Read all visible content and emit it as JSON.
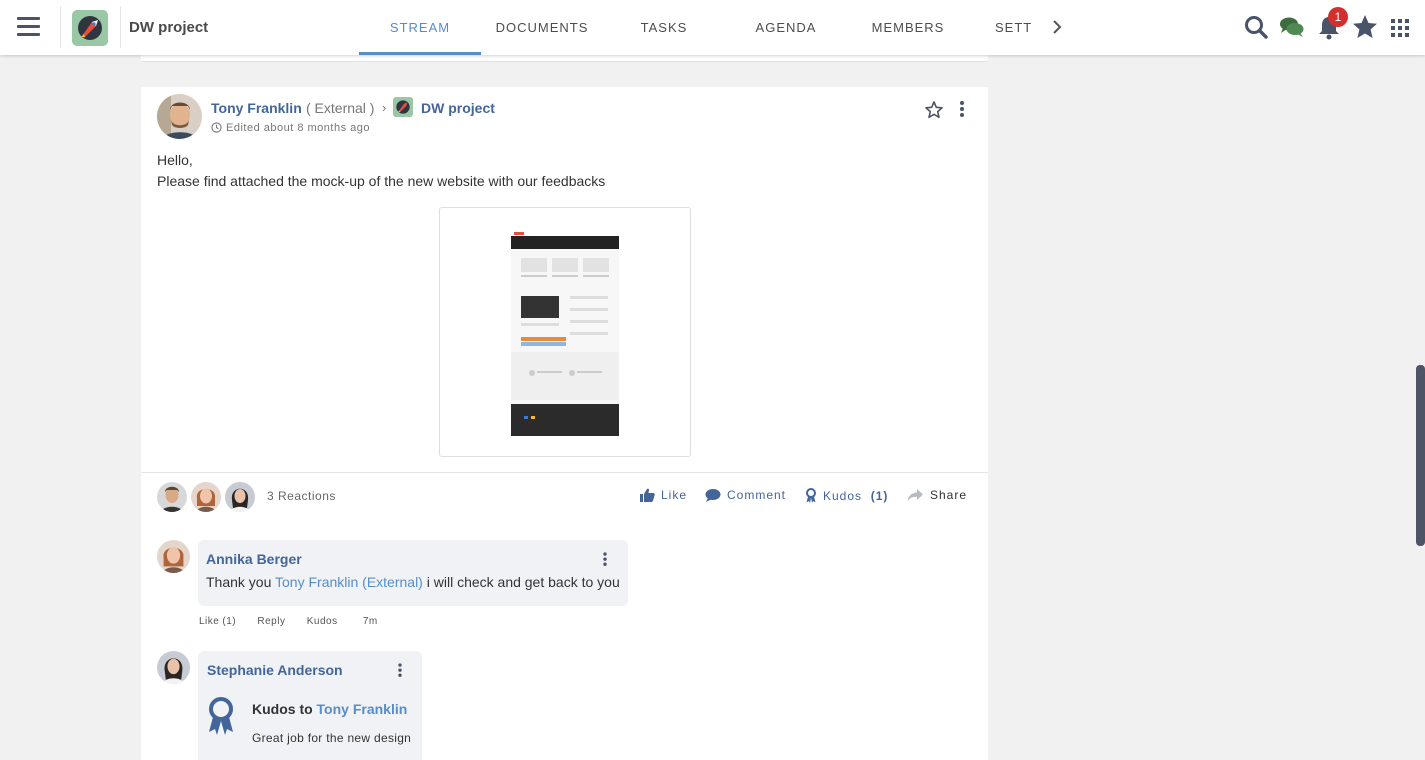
{
  "app": {
    "space_name": "DW project"
  },
  "tabs": [
    "STREAM",
    "DOCUMENTS",
    "TASKS",
    "AGENDA",
    "MEMBERS",
    "SETT"
  ],
  "active_tab": "STREAM",
  "notifications": {
    "count": "1"
  },
  "colors": {
    "accent": "#578dc9",
    "link": "#43659a",
    "badge": "#d32f2f",
    "chat": "#3d6d3f",
    "icon": "#4a5468"
  },
  "icons": [
    "hamburger-icon",
    "search-icon",
    "chat-icon",
    "bell-icon",
    "star-icon",
    "apps-grid-icon"
  ],
  "post": {
    "author": "Tony Franklin",
    "author_tag": "( External )",
    "space": "DW project",
    "edited": "Edited about 8 months ago",
    "body_line1": "Hello,",
    "body_line2": "Please find attached the mock-up of the new website with our feedbacks",
    "reactions": "3 Reactions",
    "actions": {
      "like": "Like",
      "comment": "Comment",
      "kudos": "Kudos",
      "kudos_count": "(1)",
      "share": "Share"
    }
  },
  "comments": [
    {
      "author": "Annika Berger",
      "text_before": "Thank you ",
      "mention": "Tony Franklin (External)",
      "text_after": " i will check and get back to you",
      "like": "Like",
      "like_count": "(1)",
      "reply": "Reply",
      "kudos": "Kudos",
      "time": "7m"
    },
    {
      "author": "Stephanie Anderson",
      "kudos_prefix": "Kudos to ",
      "kudos_target": "Tony Franklin",
      "kudos_message": "Great job for the new design"
    }
  ]
}
